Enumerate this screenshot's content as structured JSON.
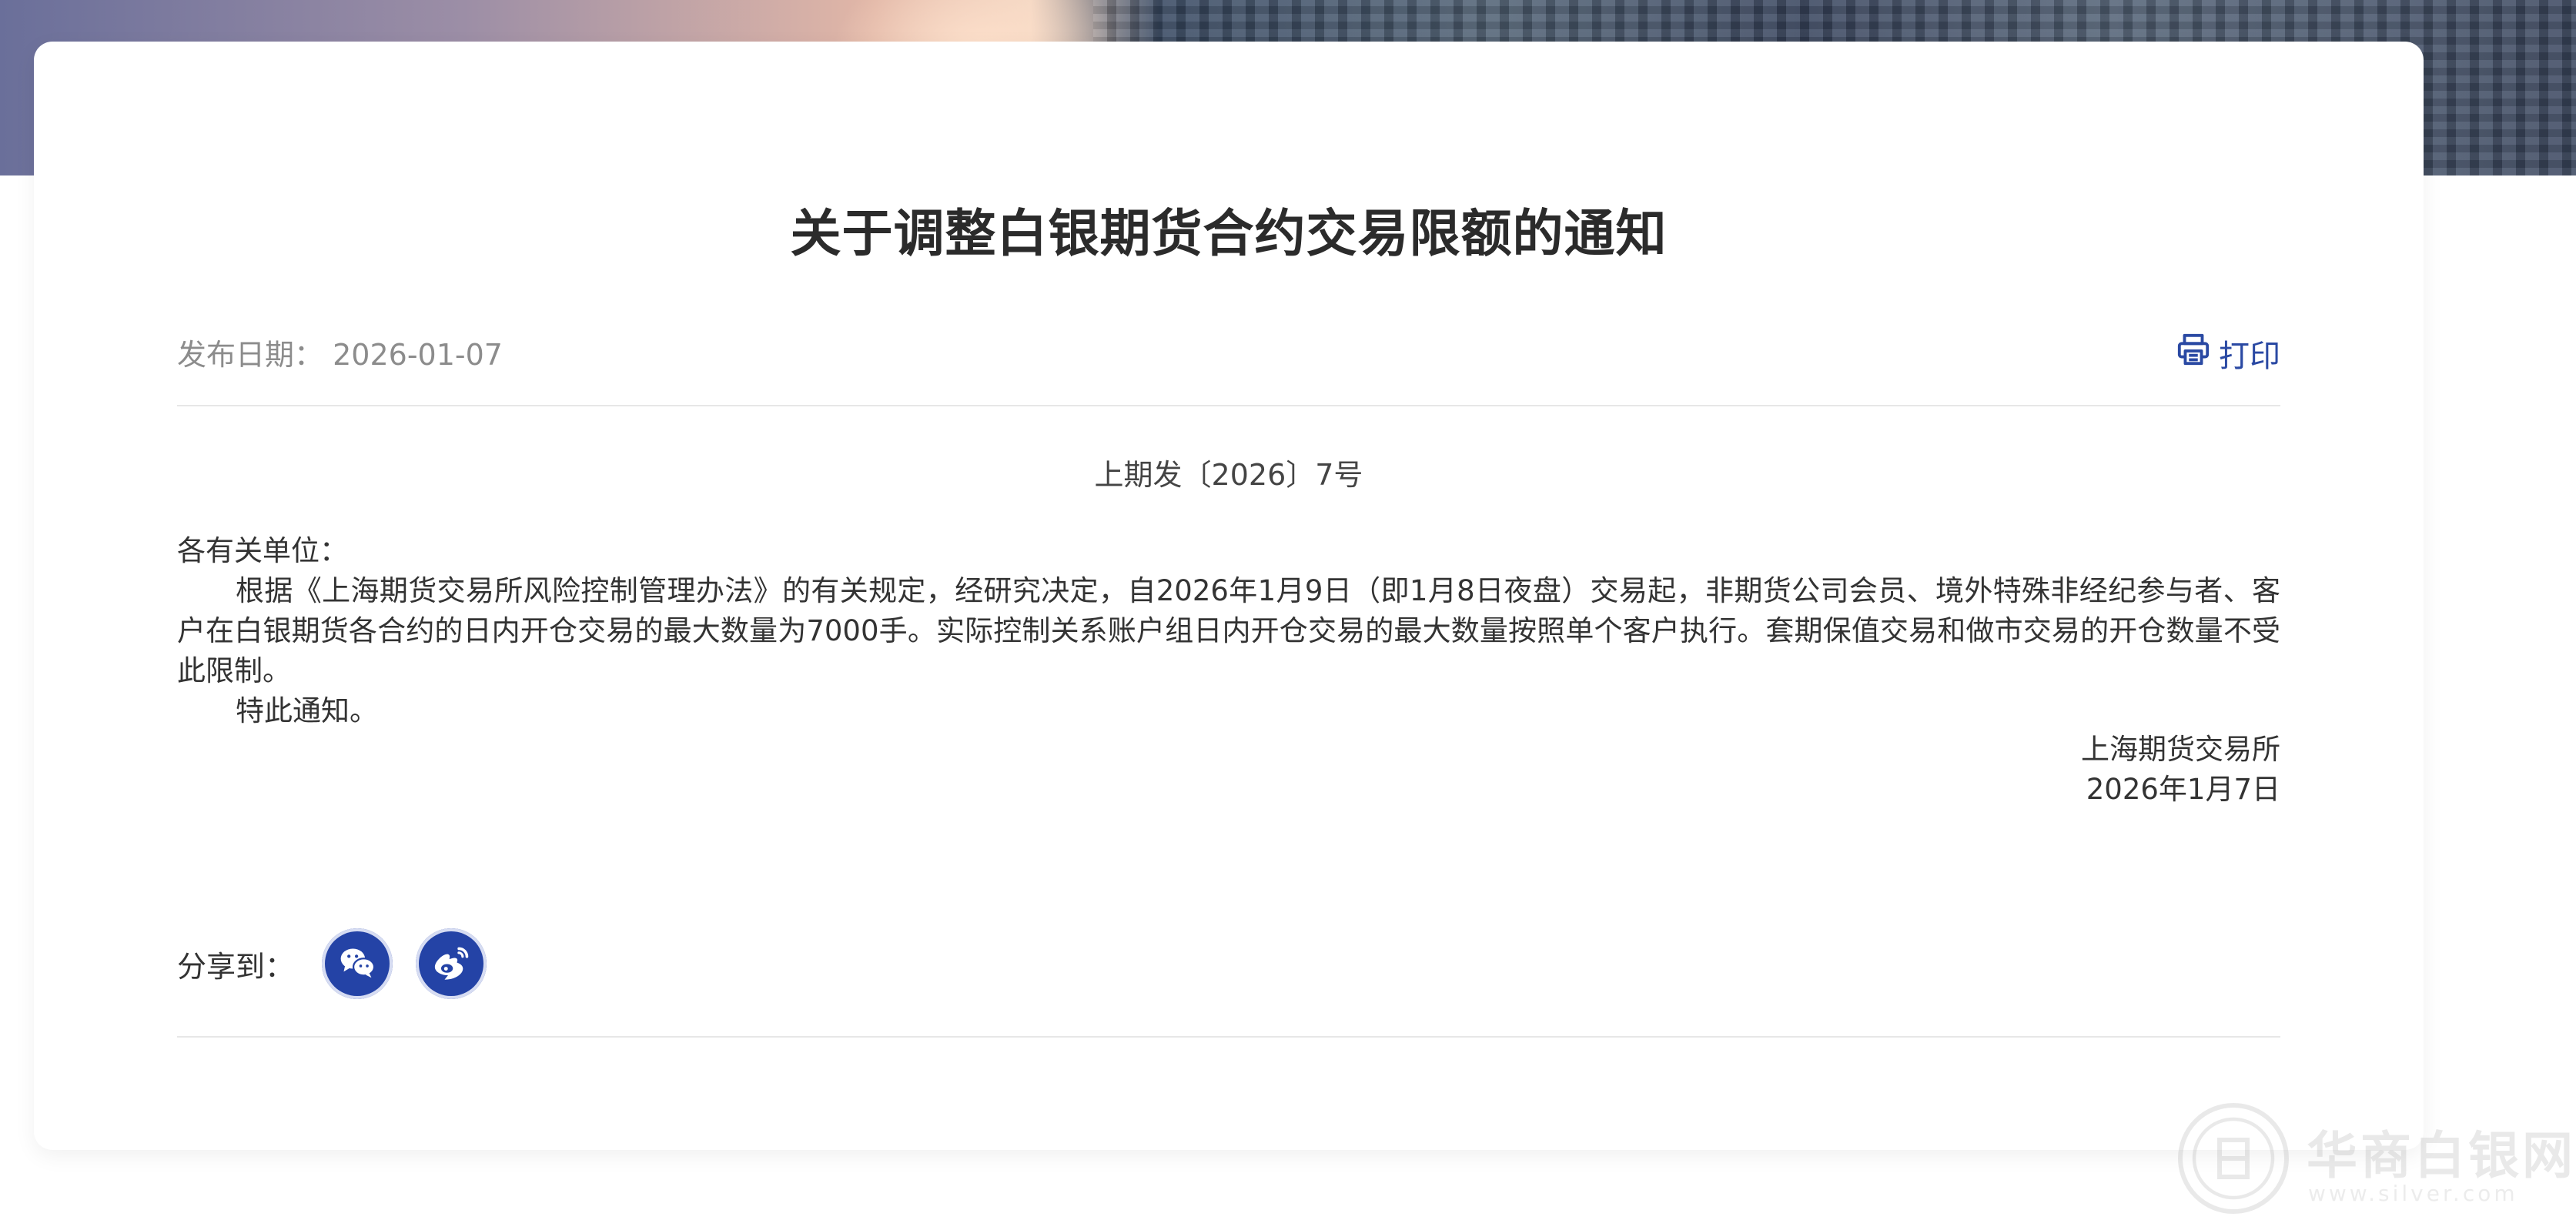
{
  "notice": {
    "title": "关于调整白银期货合约交易限额的通知",
    "publish_date_label": "发布日期：",
    "publish_date": "2026-01-07",
    "print_label": "打印",
    "doc_number": "上期发〔2026〕7号",
    "salutation": "各有关单位：",
    "paragraph_1": "根据《上海期货交易所风险控制管理办法》的有关规定，经研究决定，自2026年1月9日（即1月8日夜盘）交易起，非期货公司会员、境外特殊非经纪参与者、客户在白银期货各合约的日内开仓交易的最大数量为7000手。实际控制关系账户组日内开仓交易的最大数量按照单个客户执行。套期保值交易和做市交易的开仓数量不受此限制。",
    "paragraph_2": "特此通知。",
    "signature_org": "上海期货交易所",
    "signature_date": "2026年1月7日"
  },
  "share": {
    "label": "分享到：",
    "buttons": [
      {
        "icon": "wechat-icon"
      },
      {
        "icon": "weibo-icon"
      }
    ]
  },
  "watermark": {
    "text": "华商白银网",
    "subtext": "www.silver.com"
  },
  "colors": {
    "accent": "#2443a6",
    "print_link": "#2a49a3",
    "title": "#2b2b2b",
    "muted": "#8c8c8c",
    "divider": "#e7e7e7"
  }
}
